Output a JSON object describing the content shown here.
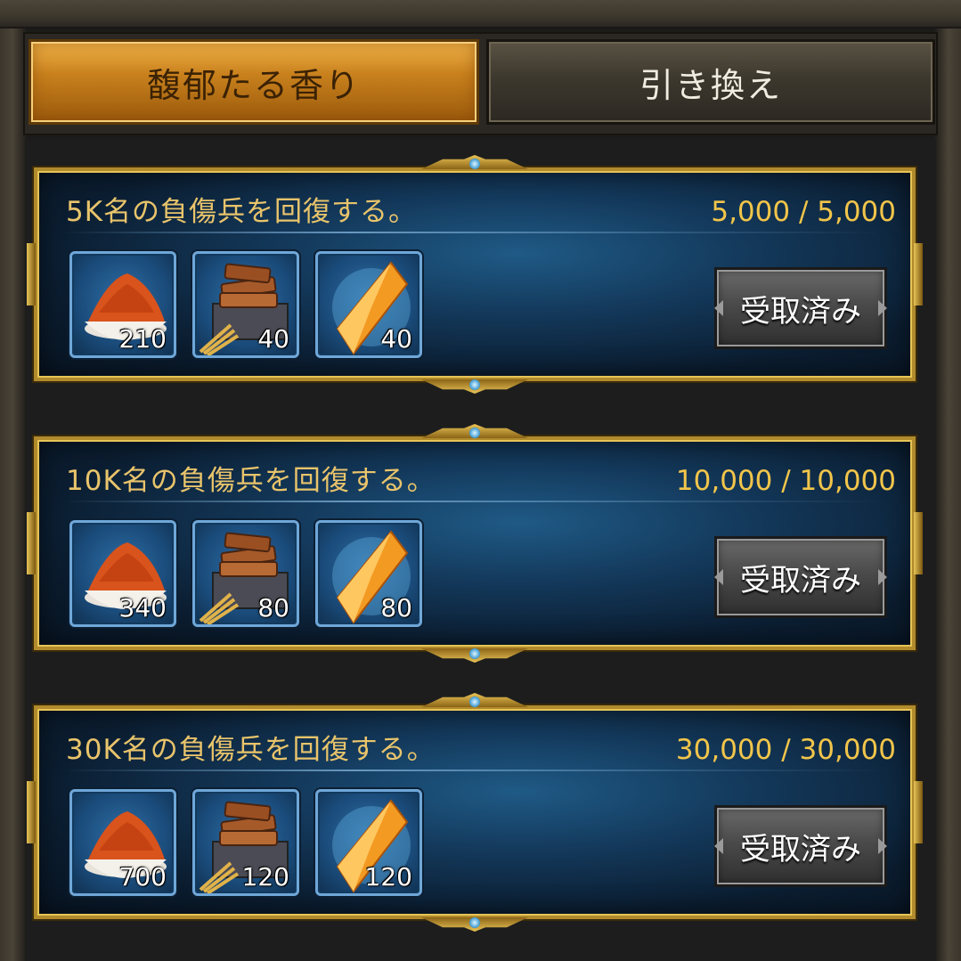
{
  "tabs": [
    {
      "label": "馥郁たる香り",
      "active": true
    },
    {
      "label": "引き換え",
      "active": false
    }
  ],
  "colors": {
    "active_tab": "#c9811d",
    "card_border": "#b08a2c",
    "title_text": "#e9c46b",
    "progress_text": "#f2c54a",
    "button": "#4a4a4a"
  },
  "quests": [
    {
      "title": "5K名の負傷兵を回復する。",
      "progress": "5,000 / 5,000",
      "rewards": [
        {
          "icon": "spice-bowl-icon",
          "qty": "210"
        },
        {
          "icon": "wood-wheat-crate-icon",
          "qty": "40"
        },
        {
          "icon": "orange-crystal-icon",
          "qty": "40"
        }
      ],
      "button": "受取済み"
    },
    {
      "title": "10K名の負傷兵を回復する。",
      "progress": "10,000 / 10,000",
      "rewards": [
        {
          "icon": "spice-bowl-icon",
          "qty": "340"
        },
        {
          "icon": "wood-wheat-crate-icon",
          "qty": "80"
        },
        {
          "icon": "orange-crystal-icon",
          "qty": "80"
        }
      ],
      "button": "受取済み"
    },
    {
      "title": "30K名の負傷兵を回復する。",
      "progress": "30,000 / 30,000",
      "rewards": [
        {
          "icon": "spice-bowl-icon",
          "qty": "700"
        },
        {
          "icon": "wood-wheat-crate-icon",
          "qty": "120"
        },
        {
          "icon": "orange-crystal-icon",
          "qty": "120"
        }
      ],
      "button": "受取済み"
    }
  ]
}
